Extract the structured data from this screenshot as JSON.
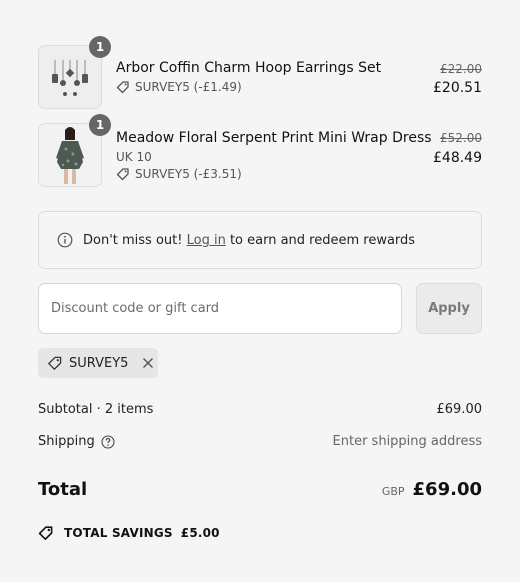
{
  "items": [
    {
      "name": "Arbor Coffin Charm Hoop Earrings Set",
      "quantity": "1",
      "variant": "",
      "discount": "SURVEY5 (-£1.49)",
      "original_price": "£22.00",
      "price": "£20.51"
    },
    {
      "name": "Meadow Floral Serpent Print Mini Wrap Dress",
      "quantity": "1",
      "variant": "UK 10",
      "discount": "SURVEY5 (-£3.51)",
      "original_price": "£52.00",
      "price": "£48.49"
    }
  ],
  "rewards": {
    "prefix": "Don't miss out!",
    "link": "Log in",
    "suffix": "to earn and redeem rewards"
  },
  "discount_field": {
    "placeholder": "Discount code or gift card",
    "value": "",
    "apply_label": "Apply"
  },
  "applied_code": "SURVEY5",
  "summary": {
    "subtotal_label": "Subtotal · 2 items",
    "subtotal_value": "£69.00",
    "shipping_label": "Shipping",
    "shipping_value": "Enter shipping address",
    "total_label": "Total",
    "currency": "GBP",
    "total_value": "£69.00",
    "savings_label": "TOTAL SAVINGS",
    "savings_value": "£5.00"
  },
  "colors": {
    "background": "#f5f5f5",
    "badge": "#666666",
    "apply_button": "#ebebeb",
    "chip": "#e6e6e6"
  }
}
